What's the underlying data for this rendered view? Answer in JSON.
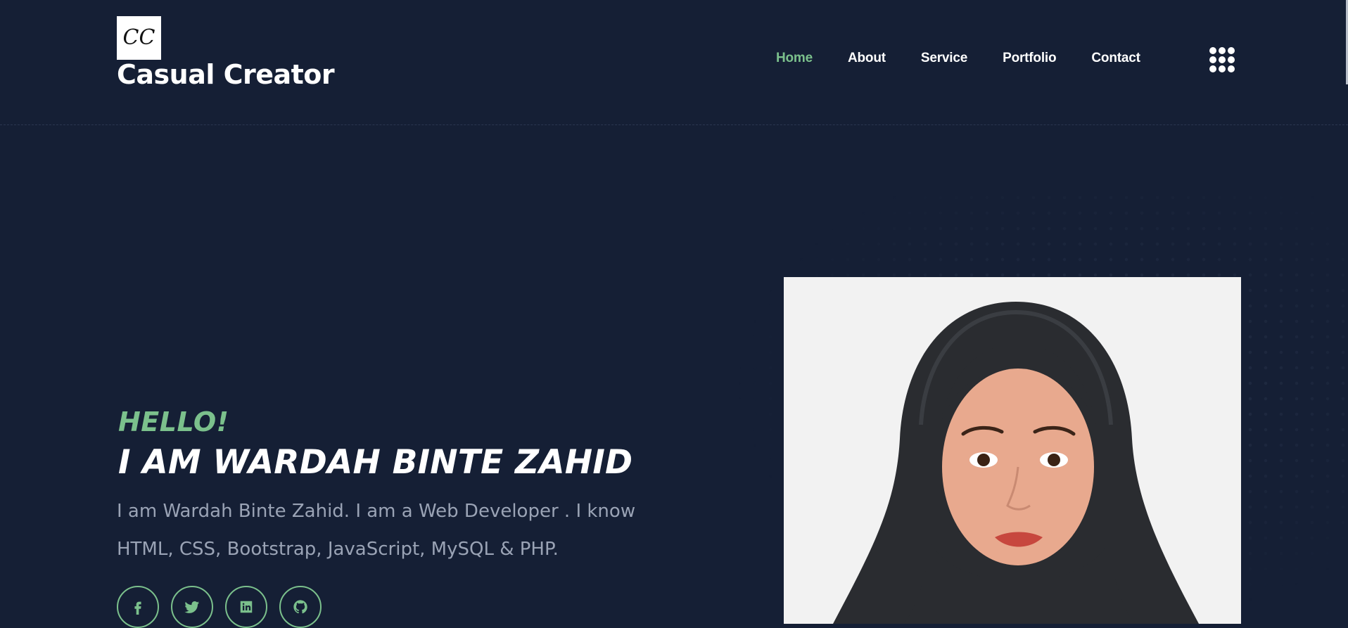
{
  "header": {
    "logo_mark": "CC",
    "brand_name": "Casual Creator"
  },
  "nav": {
    "items": [
      {
        "label": "Home",
        "active": true
      },
      {
        "label": "About",
        "active": false
      },
      {
        "label": "Service",
        "active": false
      },
      {
        "label": "Portfolio",
        "active": false
      },
      {
        "label": "Contact",
        "active": false
      }
    ],
    "menu_icon": "grid-menu-icon"
  },
  "hero": {
    "greeting": "HELLO!",
    "headline": "I AM WARDAH BINTE ZAHID",
    "intro": "I am Wardah Binte Zahid. I am a Web Developer . I know HTML, CSS, Bootstrap, JavaScript, MySQL & PHP.",
    "socials": [
      "facebook-icon",
      "twitter-icon",
      "linkedin-icon",
      "github-icon"
    ],
    "photo": "profile-photo"
  },
  "colors": {
    "background": "#151f35",
    "accent": "#7bc08c",
    "text_muted": "#9aa3b5"
  }
}
